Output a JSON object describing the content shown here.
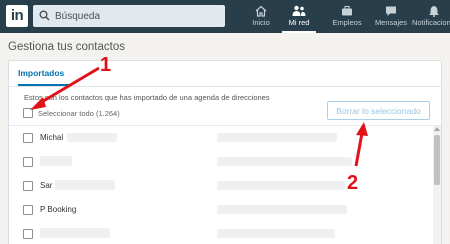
{
  "topbar": {
    "logo_text": "in",
    "search_placeholder": "Búsqueda",
    "nav": [
      {
        "label": "Inicio",
        "icon": "home-icon"
      },
      {
        "label": "Mi red",
        "icon": "network-icon",
        "active": true
      },
      {
        "label": "Empleos",
        "icon": "briefcase-icon"
      },
      {
        "label": "Mensajes",
        "icon": "messages-icon"
      },
      {
        "label": "Notificaciones",
        "icon": "bell-icon"
      }
    ]
  },
  "page": {
    "title": "Gestiona tus contactos"
  },
  "tabs": {
    "imported": "Importados"
  },
  "content": {
    "description": "Estos son los contactos que has importado de una agenda de direcciones",
    "select_all": "Seleccionar todo (1.264)",
    "remove_button": "Borrar lo seleccionado"
  },
  "contacts": [
    {
      "name": "Michal"
    },
    {
      "name": ""
    },
    {
      "name": "Sar"
    },
    {
      "name": "P Booking"
    },
    {
      "name": ""
    }
  ],
  "annotations": {
    "step1": "1",
    "step2": "2",
    "color": "#e2121b"
  }
}
